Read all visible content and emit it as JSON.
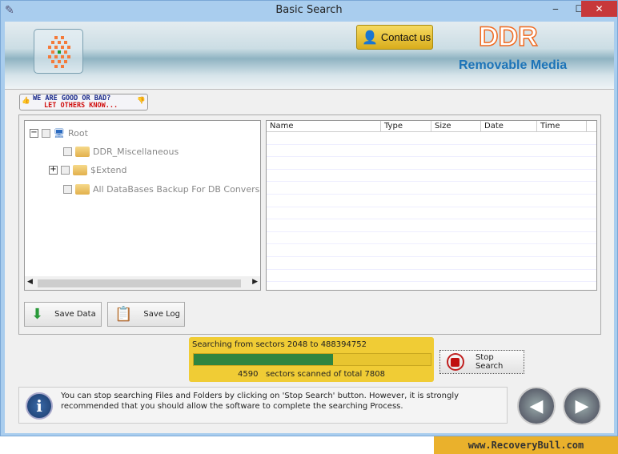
{
  "window": {
    "title": "Basic Search",
    "minimize": "‒",
    "maximize": "☐",
    "close": "✕"
  },
  "banner": {
    "contact_label": "Contact us",
    "brand": "DDR",
    "product": "Removable Media",
    "rate_line1": "WE ARE GOOD OR BAD?",
    "rate_line2": "LET OTHERS KNOW..."
  },
  "tree": {
    "root": "Root",
    "items": [
      "DDR_Miscellaneous",
      "$Extend",
      "All DataBases Backup For DB Conversion Software"
    ]
  },
  "list": {
    "columns": [
      "Name",
      "Type",
      "Size",
      "Date",
      "Time"
    ],
    "rows": []
  },
  "buttons": {
    "save_data": "Save Data",
    "save_log": "Save Log",
    "stop_search": "Stop Search"
  },
  "progress": {
    "range_text": "Searching from sectors 2048 to 488394752",
    "scanned": "4590",
    "scanned_text": "sectors scanned of total 7808",
    "total": 7808,
    "percent": 58.8,
    "color": "#2f8540"
  },
  "info": {
    "text": "You can stop searching Files and Folders by clicking on 'Stop Search' button. However, it is strongly recommended that you should allow the software to complete the searching Process."
  },
  "footer": {
    "url": "www.RecoveryBull.com"
  }
}
